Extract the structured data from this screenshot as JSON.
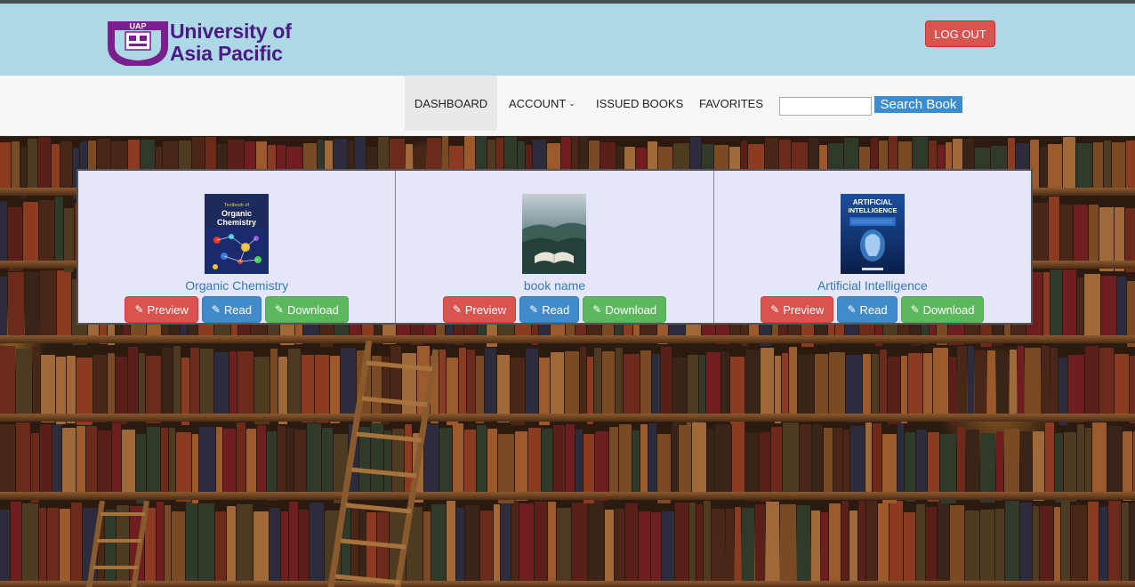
{
  "header": {
    "logo_line1": "University of",
    "logo_line2": "Asia Pacific",
    "crest_text": "UAP",
    "logout_label": "LOG OUT"
  },
  "nav": {
    "items": [
      {
        "label": "DASHBOARD"
      },
      {
        "label": "ACCOUNT"
      },
      {
        "label": "ISSUED BOOKS"
      },
      {
        "label": "FAVORITES"
      }
    ],
    "search_button": "Search Book",
    "search_value": ""
  },
  "books": [
    {
      "title": "Organic Chemistry",
      "cover_line1": "Textbook of",
      "cover_line2": "Organic",
      "cover_line3": "Chemistry"
    },
    {
      "title": "book name"
    },
    {
      "title": "Artificial Intelligence",
      "cover_line1": "ARTIFICIAL",
      "cover_line2": "INTELLIGENCE"
    }
  ],
  "actions": {
    "preview": "Preview",
    "read": "Read",
    "download": "Download"
  },
  "colors": {
    "header_bg": "#add8e6",
    "danger": "#d9534f",
    "primary": "#428bca",
    "success": "#5cb85c",
    "link": "#337ab7",
    "panel_bg": "#e6e6fa"
  }
}
